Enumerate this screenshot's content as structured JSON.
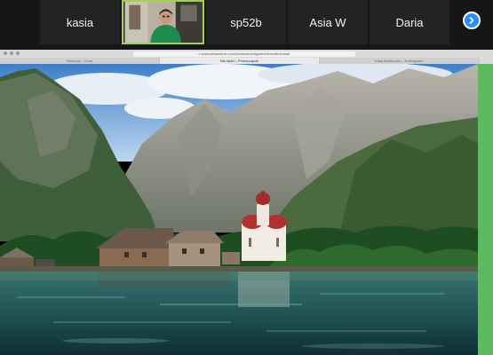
{
  "participants": [
    {
      "name": "kasia"
    },
    {
      "name": "",
      "video": true
    },
    {
      "name": "sp52b"
    },
    {
      "name": "Asia W"
    },
    {
      "name": "Daria"
    }
  ],
  "browser": {
    "url": "c.www.tatrascenic.com/photos/koenigssee/st-bartholomae",
    "tabs": [
      "Ilustracje – Góra",
      "Nie lipdd – Przesunięcie",
      "trasy.fotolia.com – Koenigssee"
    ]
  },
  "icons": {
    "next": "chevron-right-icon"
  },
  "colors": {
    "active_border": "#9fd34b",
    "accent": "#2d8cff",
    "side_panel": "#5cba60"
  }
}
